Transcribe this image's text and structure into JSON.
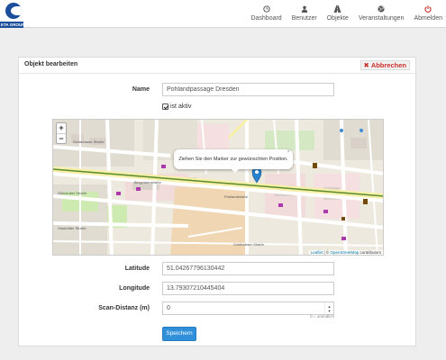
{
  "brand": {
    "logo_text": "ETA GROUP"
  },
  "nav": {
    "items": [
      {
        "label": "Dashboard",
        "icon": "clock-icon"
      },
      {
        "label": "Benutzer",
        "icon": "user-icon"
      },
      {
        "label": "Objekte",
        "icon": "road-icon"
      },
      {
        "label": "Veranstaltungen",
        "icon": "globe-icon"
      },
      {
        "label": "Abmelden",
        "icon": "power-icon"
      }
    ]
  },
  "panel": {
    "title": "Objekt bearbeiten",
    "cancel_label": "Abbrechen"
  },
  "form": {
    "name_label": "Name",
    "name_value": "Pohlandpassage Dresden",
    "active_label": "ist aktiv",
    "active_checked": true,
    "latitude_label": "Latitude",
    "latitude_value": "51.04267796130442",
    "longitude_label": "Longitude",
    "longitude_value": "13.79307210445404",
    "scan_label": "Scan-Distanz (m)",
    "scan_value": "0",
    "scan_hint": "0 = unendlich",
    "save_label": "Speichern"
  },
  "map": {
    "popup_text": "Ziehen Sie den Marker zur gewünschten Position.",
    "popup_close": "×",
    "zoom_in": "+",
    "zoom_out": "−",
    "attribution_leaflet": "Leaflet",
    "attribution_sep": " | © ",
    "attribution_osm": "OpenStreetMap",
    "attribution_tail": " contributors",
    "street_labels": [
      "Schandauer Straße",
      "Gleichulter Straße",
      "Pohlandstraße",
      "Glashütter Straße",
      "Gottleubaer Straße",
      "Bergmannstraße"
    ],
    "colors": {
      "marker": "#2a81cb",
      "tram": "#5a8a2f",
      "residential": "#e0dcd2"
    }
  }
}
